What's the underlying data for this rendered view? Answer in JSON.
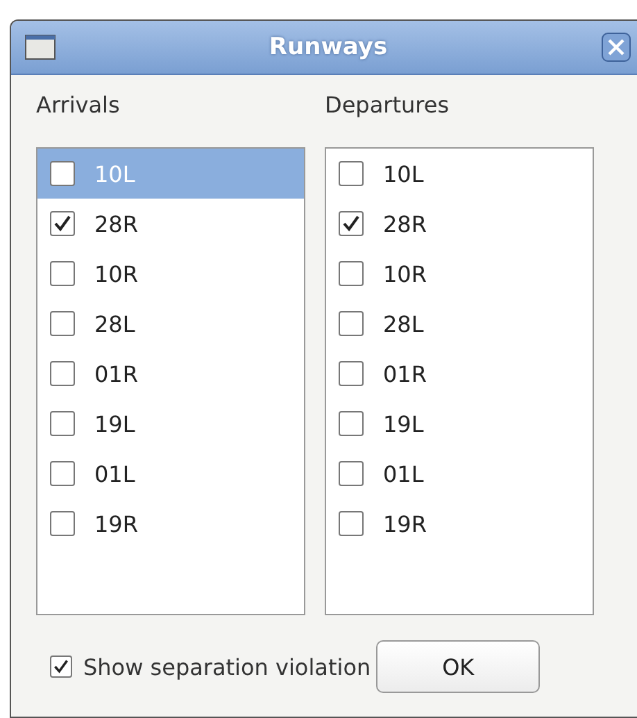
{
  "window": {
    "title": "Runways"
  },
  "lists": [
    {
      "label": "Arrivals",
      "items": [
        {
          "name": "10L",
          "checked": false,
          "selected": true
        },
        {
          "name": "28R",
          "checked": true,
          "selected": false
        },
        {
          "name": "10R",
          "checked": false,
          "selected": false
        },
        {
          "name": "28L",
          "checked": false,
          "selected": false
        },
        {
          "name": "01R",
          "checked": false,
          "selected": false
        },
        {
          "name": "19L",
          "checked": false,
          "selected": false
        },
        {
          "name": "01L",
          "checked": false,
          "selected": false
        },
        {
          "name": "19R",
          "checked": false,
          "selected": false
        }
      ]
    },
    {
      "label": "Departures",
      "items": [
        {
          "name": "10L",
          "checked": false,
          "selected": false
        },
        {
          "name": "28R",
          "checked": true,
          "selected": false
        },
        {
          "name": "10R",
          "checked": false,
          "selected": false
        },
        {
          "name": "28L",
          "checked": false,
          "selected": false
        },
        {
          "name": "01R",
          "checked": false,
          "selected": false
        },
        {
          "name": "19L",
          "checked": false,
          "selected": false
        },
        {
          "name": "01L",
          "checked": false,
          "selected": false
        },
        {
          "name": "19R",
          "checked": false,
          "selected": false
        }
      ]
    }
  ],
  "show_violations": {
    "label": "Show separation violation",
    "checked": true
  },
  "buttons": [
    "OK"
  ]
}
